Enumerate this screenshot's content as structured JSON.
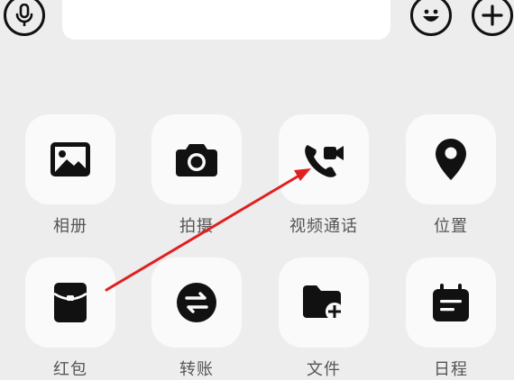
{
  "input_bar": {
    "voice_icon": "microphone-icon",
    "emoji_icon": "smile-icon",
    "more_icon": "plus-circle-icon"
  },
  "panel": {
    "items": [
      {
        "label": "相册",
        "icon": "image-icon"
      },
      {
        "label": "拍摄",
        "icon": "camera-icon"
      },
      {
        "label": "视频通话",
        "icon": "video-call-icon"
      },
      {
        "label": "位置",
        "icon": "location-pin-icon"
      },
      {
        "label": "红包",
        "icon": "red-packet-icon"
      },
      {
        "label": "转账",
        "icon": "transfer-icon"
      },
      {
        "label": "文件",
        "icon": "file-add-icon"
      },
      {
        "label": "日程",
        "icon": "calendar-icon"
      }
    ]
  },
  "annotation": {
    "arrow_color": "#e02020"
  }
}
